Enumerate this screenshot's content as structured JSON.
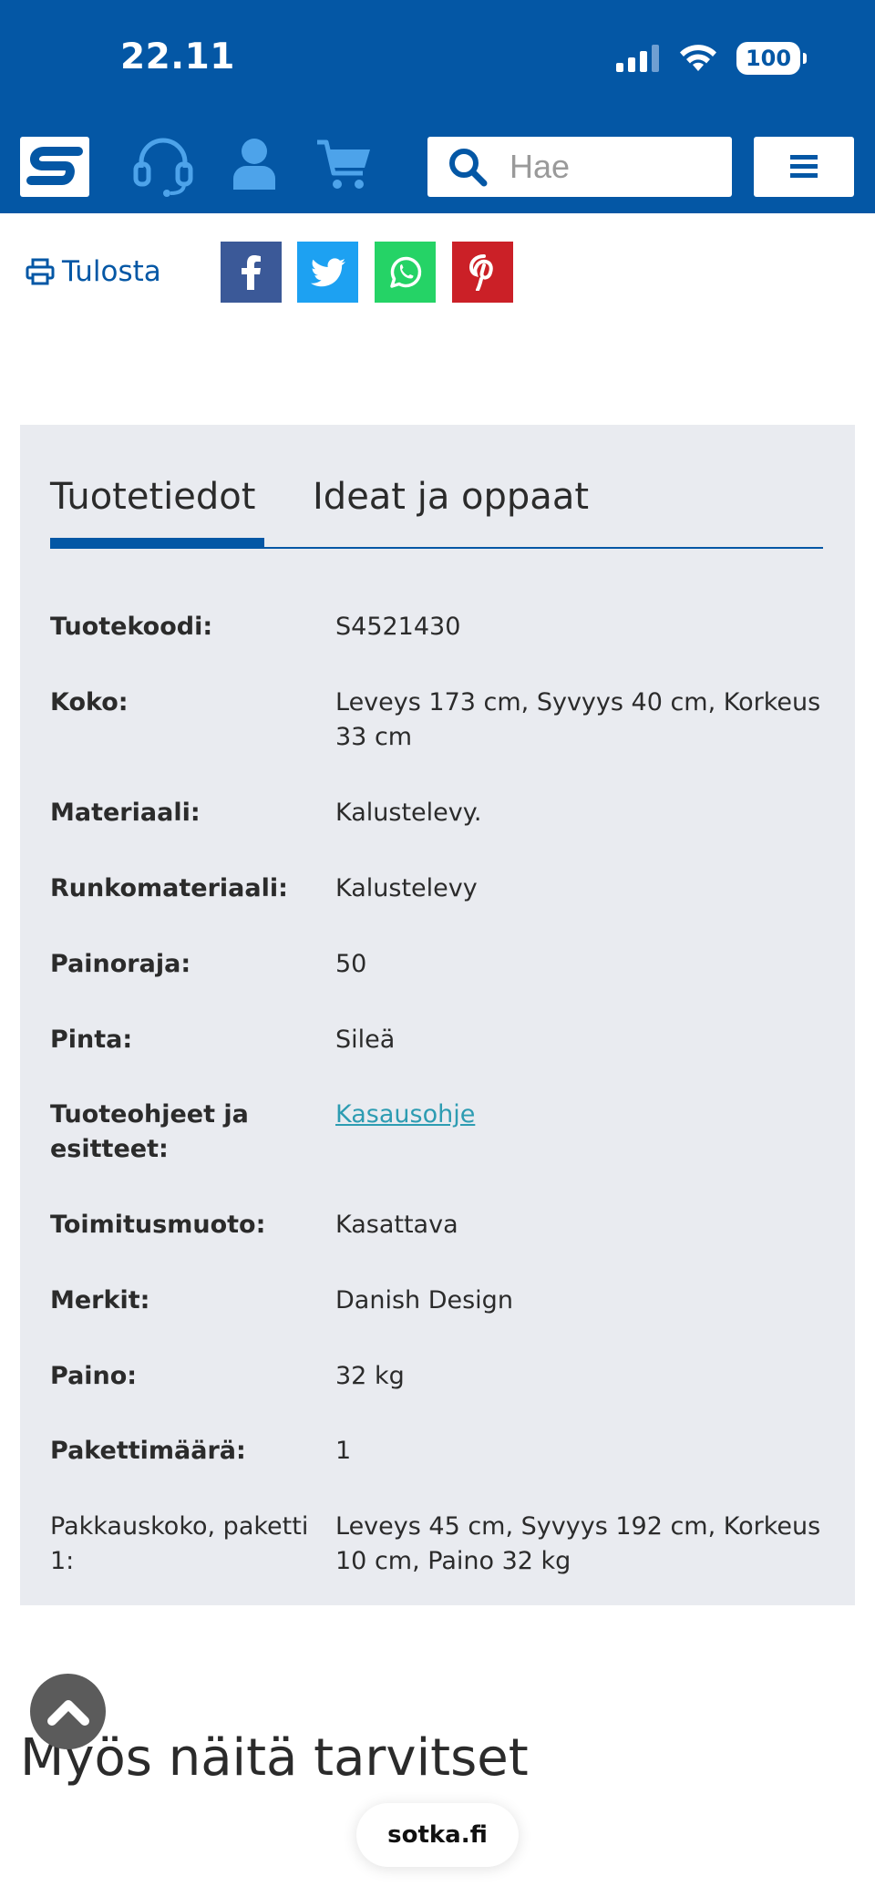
{
  "status_bar": {
    "time": "22.11",
    "battery": "100"
  },
  "header": {
    "logo_text": "S",
    "search_placeholder": "Hae"
  },
  "share": {
    "print_label": "Tulosta",
    "buttons": [
      {
        "name": "facebook",
        "color": "#3b5998"
      },
      {
        "name": "twitter",
        "color": "#1da1f2"
      },
      {
        "name": "whatsapp",
        "color": "#25d366"
      },
      {
        "name": "pinterest",
        "color": "#cb2027"
      }
    ]
  },
  "tabs": {
    "active": "Tuotetiedot",
    "other": "Ideat ja oppaat"
  },
  "specs": [
    {
      "label": "Tuotekoodi:",
      "value": "S4521430"
    },
    {
      "label": "Koko:",
      "value": "Leveys 173 cm, Syvyys 40 cm, Korkeus 33 cm"
    },
    {
      "label": "Materiaali:",
      "value": "Kalustelevy."
    },
    {
      "label": "Runkomateriaali:",
      "value": "Kalustelevy"
    },
    {
      "label": "Painoraja:",
      "value": "50"
    },
    {
      "label": "Pinta:",
      "value": "Sileä"
    },
    {
      "label": "Tuoteohjeet ja esitteet:",
      "value": "Kasausohje"
    },
    {
      "label": "Toimitusmuoto:",
      "value": "Kasattava"
    },
    {
      "label": "Merkit:",
      "value": "Danish Design"
    },
    {
      "label": "Paino:",
      "value": "32 kg"
    },
    {
      "label": "Pakettimäärä:",
      "value": "1"
    },
    {
      "label": "Pakkauskoko, paketti 1:",
      "value": "Leveys 45 cm, Syvyys 192 cm, Korkeus 10 cm, Paino 32 kg"
    }
  ],
  "section_title": "Myös näitä tarvitset",
  "browser_url": "sotka.fi",
  "colors": {
    "brand_blue": "#0457a5",
    "panel_bg": "#e9ebf0",
    "link": "#2d9cb2",
    "icon_light_blue": "#4da3ea"
  }
}
